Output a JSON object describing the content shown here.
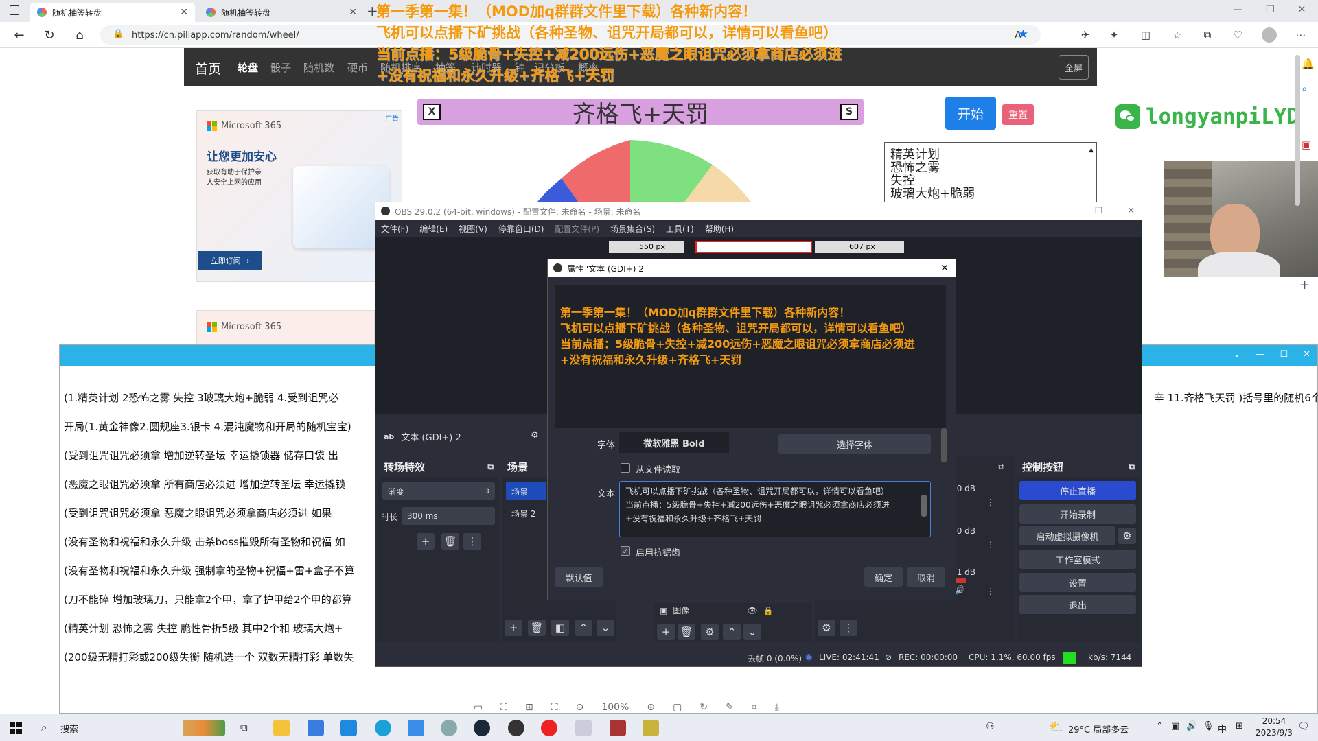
{
  "browser": {
    "tabs": [
      {
        "title": "随机抽签转盘"
      },
      {
        "title": "随机抽签转盘"
      }
    ],
    "url": "https://cn.piliapp.com/random/wheel/"
  },
  "site": {
    "nav": [
      "首页",
      "轮盘",
      "骰子",
      "随机数",
      "硬币",
      "随机排序",
      "抽签",
      "计时器",
      "钟",
      "记分板",
      "概率"
    ],
    "fullscreen_label": "全屏",
    "result": "齐格飞+天罚",
    "result_left_btn": "X",
    "result_right_btn": "S",
    "start_label": "开始",
    "reset_label": "重置",
    "items": [
      "精英计划",
      "恐怖之雾",
      "失控",
      "玻璃大炮+脆弱"
    ]
  },
  "ad": {
    "brand": "Microsoft 365",
    "tag": "广告",
    "headline": "让您更加安心",
    "sub": "获取有助于保护亲\n人安全上网的应用",
    "cta": "立即订阅 →",
    "brand2": "Microsoft 365"
  },
  "stream": {
    "wechat_id": "longyanpiLYD",
    "overlay": [
      "第一季第一集！（MOD加q群群文件里下载）各种新内容！",
      "飞机可以点播下矿挑战（各种圣物、诅咒开局都可以，详情可以看鱼吧）",
      "当前点播：5级脆骨+失控+减200远伤+恶魔之眼诅咒必须拿商店必须进",
      "+没有祝福和永久升级+齐格飞+天罚"
    ]
  },
  "notes": {
    "lines": [
      "(1.精英计划  2恐怖之雾 失控  3玻璃大炮+脆弱 4.受到诅咒必",
      "开局(1.黄金神像2.圆规座3.银卡 4.混沌魔物和开局的随机宝宝)",
      "(受到诅咒诅咒必须拿   增加逆转圣坛   幸运撬锁器 储存口袋  出",
      "(恶魔之眼诅咒必须拿 所有商店必须进    增加逆转圣坛 幸运撬锁",
      "(受到诅咒诅咒必须拿    恶魔之眼诅咒必须拿商店必须进     如果",
      "(没有圣物和祝福和永久升级 击杀boss摧毁所有圣物和祝福    如",
      "(没有圣物和祝福和永久升级    强制拿的圣物+祝福+雷+盒子不算",
      "  (刀不能碎  增加玻璃刀，只能拿2个甲，拿了护甲给2个甲的都算",
      "  (精英计划     恐怖之雾 失控   脆性骨折5级 其中2个和 玻璃大炮+",
      "(200级无精打彩或200级失衡      随机选一个 双数无精打彩 单数失"
    ],
    "right_fragment": "辛 11.齐格飞天罚 )括号里的随机6个"
  },
  "obs": {
    "title": "OBS 29.0.2 (64-bit, windows) - 配置文件: 未命名 - 场景: 未命名",
    "menu": [
      "文件(F)",
      "编辑(E)",
      "视图(V)",
      "停靠窗口(D)",
      "配置文件(P)",
      "场景集合(S)",
      "工具(T)",
      "帮助(H)"
    ],
    "ruler_left": "550 px",
    "ruler_right": "607 px",
    "source_name": "文本 (GDI+) 2",
    "transitions_title": "转场特效",
    "transition_value": "渐变",
    "duration_label": "时长",
    "duration_value": "300 ms",
    "scenes_title": "场景",
    "scenes": [
      "场景",
      "场景 2"
    ],
    "source_item": "图像",
    "controls_title": "控制按钮",
    "controls": [
      "停止直播",
      "开始录制",
      "启动虚拟摄像机",
      "工作室模式",
      "设置",
      "退出"
    ],
    "mixer": [
      "-0.0 dB",
      "0.0 dB",
      "-0.1 dB"
    ],
    "status": {
      "dropped": "丢帧 0 (0.0%)",
      "live": "LIVE: 02:41:41",
      "rec": "REC: 00:00:00",
      "cpu": "CPU: 1.1%, 60.00 fps",
      "kbs": "kb/s: 7144"
    }
  },
  "props": {
    "title": "属性 '文本 (GDI+) 2'",
    "font_label": "字体",
    "font_value": "微软雅黑 Bold",
    "choose_font": "选择字体",
    "read_file": "从文件读取",
    "text_label": "文本",
    "text_value": "飞机可以点播下矿挑战（各种圣物、诅咒开局都可以，详情可以看鱼吧）\n当前点播：5级脆骨+失控+减200远伤+恶魔之眼诅咒必须拿商店必须进\n+没有祝福和永久升级+齐格飞+天罚",
    "antialias": "启用抗锯齿",
    "defaults": "默认值",
    "ok": "确定",
    "cancel": "取消"
  },
  "bottom_toolbar": {
    "zoom": "100%"
  },
  "taskbar": {
    "search": "搜索",
    "weather": "29°C 局部多云",
    "ime": "中",
    "time": "20:54",
    "date": "2023/9/3"
  }
}
